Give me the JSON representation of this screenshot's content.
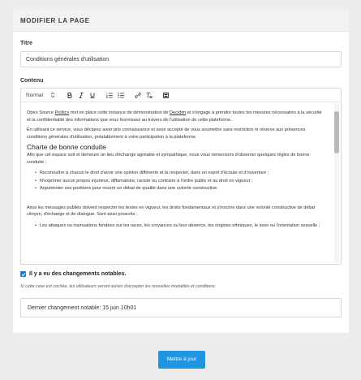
{
  "header": {
    "title": "MODIFIER LA PAGE"
  },
  "form": {
    "title_label": "Titre",
    "title_value": "Conditions générales d'utilisation",
    "content_label": "Contenu",
    "toolbar": {
      "format_select": "Normal",
      "buttons": [
        "bold",
        "italic",
        "underline",
        "ordered-list",
        "bullet-list",
        "link",
        "clear-format",
        "image"
      ]
    },
    "content": {
      "para1_a": "Open Source ",
      "para1_link1": "Politics",
      "para1_b": " met en place cette instance de démonstration de ",
      "para1_link2": "Decidim",
      "para1_c": " et s'engage à prendre toutes les mesures nécessaires à la sécurité et la confidentialité des informations que vous fournissez au travers de l'utilisation de cette plateforme.",
      "para2": "En utilisant ce service, vous déclarez avoir pris connaissance et avoir accepté de vous soumettre sans restriction ni réserve aux présences conditions générales d'utilisation, préalablement à votre participation à la plateforme.",
      "heading": "Charte de bonne conduite",
      "para3": "Afin que cet espace soit et demeure un lieu d'échange agréable et sympathique, nous vous remercions d'observer quelques règles de bonne conduite :",
      "bullets": [
        "Reconnaître à chacun le droit d'avoir une opinion différente et la respecter, dans un esprit d'écoute et d'ouverture ;",
        "N'exprimer aucun propos injurieux, diffamatoire, raciste ou contraire à l'ordre public et au droit en vigueur ;",
        "Argumenter ses positions pour nourrir un débat de qualité dans une volonté constructive."
      ],
      "para4": "Ainsi les messages publiés doivent respecter les textes en vigueur, les droits fondamentaux et s'inscrire dans une volonté constructive de débat citoyen, d'échange et de dialogue. Sont ainsi proscrits :",
      "bullets2": [
        "Les attaques ou insinuations fondées sur les races, les croyances ou leur absence, les origines ethniques, le sexe ou l'orientation sexuelle ;"
      ]
    },
    "checkbox_label": "Il y a eu des changements notables.",
    "checkbox_checked": true,
    "help_text": "Si cette case est cochée, les utilisateurs seront avisés d'accepter les nouvelles modalités et conditions.",
    "last_change": "Dernier changement notable: 15 juin 10h01"
  },
  "actions": {
    "submit_label": "Mettre à jour"
  },
  "colors": {
    "primary": "#2196e0",
    "checkbox": "#1a7bd6",
    "background": "#ececec"
  }
}
